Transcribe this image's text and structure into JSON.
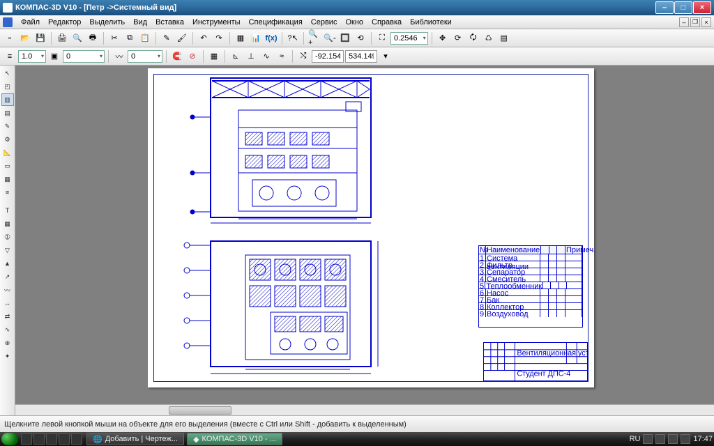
{
  "window": {
    "title": "КОМПАС-3D V10 - [Петр ->Системный вид]"
  },
  "menu": [
    "Файл",
    "Редактор",
    "Выделить",
    "Вид",
    "Вставка",
    "Инструменты",
    "Спецификация",
    "Сервис",
    "Окно",
    "Справка",
    "Библиотеки"
  ],
  "toolbar1": {
    "zoom_value": "0.2546"
  },
  "toolbar2": {
    "line_weight": "1.0",
    "layer": "0",
    "coord_x": "-92.154",
    "coord_y": "534.149"
  },
  "status": {
    "hint": "Щелкните левой кнопкой мыши на объекте для его выделения (вместе с Ctrl или Shift - добавить к выделенным)"
  },
  "taskbar": {
    "tabs": [
      {
        "label": "Добавить | Чертеж..."
      },
      {
        "label": "КОМПАС-3D V10 - ..."
      }
    ],
    "lang": "RU",
    "clock": "17:47"
  },
  "parts_table": {
    "headers": [
      "№",
      "Наименование",
      "",
      "",
      "",
      "Примеч."
    ],
    "rows": [
      "Система вентиляции",
      "Фильтр",
      "Сепаратор",
      "Смеситель",
      "Теплообменник",
      "Насос",
      "Бак",
      "Коллектор",
      "Воздуховод"
    ]
  },
  "title_block": {
    "project": "Вентиляционная установка",
    "student": "Студент ДПС-4"
  }
}
